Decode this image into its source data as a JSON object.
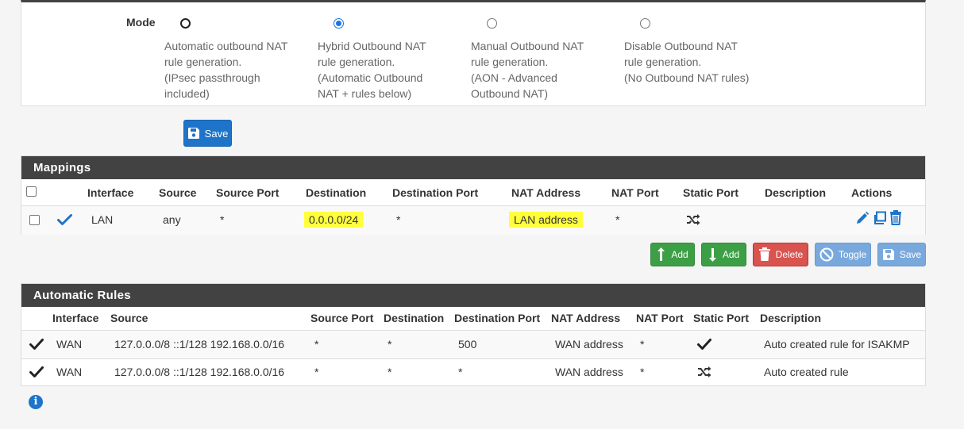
{
  "mode": {
    "label": "Mode",
    "options": [
      {
        "lines": [
          "Automatic outbound NAT",
          "rule generation.",
          "(IPsec passthrough",
          "included)"
        ],
        "checked": false
      },
      {
        "lines": [
          "Hybrid Outbound NAT",
          "rule generation.",
          "(Automatic Outbound",
          "NAT + rules below)"
        ],
        "checked": true
      },
      {
        "lines": [
          "Manual Outbound NAT",
          "rule generation.",
          "(AON - Advanced",
          "Outbound NAT)"
        ],
        "checked": false
      },
      {
        "lines": [
          "Disable Outbound NAT",
          "rule generation.",
          "(No Outbound NAT rules)"
        ],
        "checked": false
      }
    ],
    "save_label": "Save"
  },
  "mappings": {
    "title": "Mappings",
    "headers": [
      "Interface",
      "Source",
      "Source Port",
      "Destination",
      "Destination Port",
      "NAT Address",
      "NAT Port",
      "Static Port",
      "Description",
      "Actions"
    ],
    "rows": [
      {
        "interface": "LAN",
        "source": "any",
        "source_port": "*",
        "destination": "0.0.0.0/24",
        "destination_port": "*",
        "nat_address": "LAN address",
        "nat_port": "*",
        "static_port_icon": "shuffle-icon",
        "description": ""
      }
    ],
    "buttons": {
      "add_top": "Add",
      "add_bottom": "Add",
      "delete": "Delete",
      "toggle": "Toggle",
      "save": "Save"
    },
    "highlight_color": "#ffff3c"
  },
  "automatic_rules": {
    "title": "Automatic Rules",
    "headers": [
      "Interface",
      "Source",
      "Source Port",
      "Destination",
      "Destination Port",
      "NAT Address",
      "NAT Port",
      "Static Port",
      "Description"
    ],
    "rows": [
      {
        "interface": "WAN",
        "source": "127.0.0.0/8 ::1/128 192.168.0.0/16",
        "source_port": "*",
        "destination": "*",
        "destination_port": "500",
        "nat_address": "WAN address",
        "nat_port": "*",
        "static_port_icon": "check-icon",
        "description": "Auto created rule for ISAKMP"
      },
      {
        "interface": "WAN",
        "source": "127.0.0.0/8 ::1/128 192.168.0.0/16",
        "source_port": "*",
        "destination": "*",
        "destination_port": "*",
        "nat_address": "WAN address",
        "nat_port": "*",
        "static_port_icon": "shuffle-icon",
        "description": "Auto created rule"
      }
    ]
  },
  "colors": {
    "primary": "#1e74c8",
    "success": "#3d9f45",
    "danger": "#d9534f",
    "info": "#79a9dc",
    "heading": "#424242"
  }
}
